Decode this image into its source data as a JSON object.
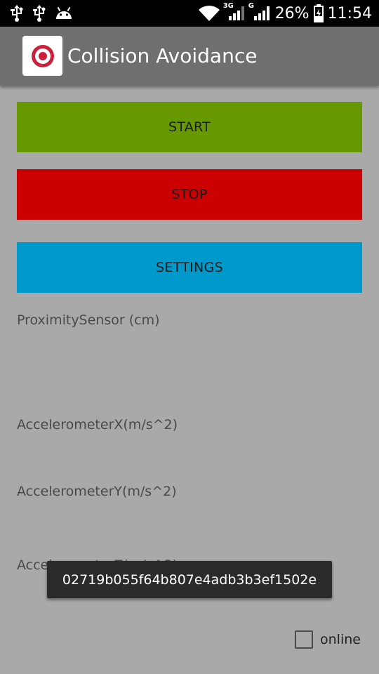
{
  "status_bar": {
    "left_icons": [
      "usb-icon",
      "usb-icon",
      "android-icon"
    ],
    "right_icons": [
      "wifi-icon",
      "signal-3g-icon",
      "signal-g-icon",
      "battery-charging-icon"
    ],
    "network_3g": "3G",
    "network_g": "G",
    "battery": "26%",
    "time": "11:54"
  },
  "app_bar": {
    "icon": "target-icon",
    "title": "Collision Avoidance"
  },
  "buttons": {
    "start": "START",
    "stop": "STOP",
    "settings": "SETTINGS"
  },
  "buttons_colors": {
    "start": "#669900",
    "stop": "#cc0000",
    "settings": "#0099cc"
  },
  "sensors": {
    "proximity": "ProximitySensor (cm)",
    "accel_x": "AccelerometerX(m/s^2)",
    "accel_y": "AccelerometerY(m/s^2)",
    "accel_z": "AccelerometerZ(m/s^2)"
  },
  "toast": {
    "message": "02719b055f64b807e4adb3b3ef1502e"
  },
  "online_checkbox": {
    "label": "online",
    "checked": false
  }
}
